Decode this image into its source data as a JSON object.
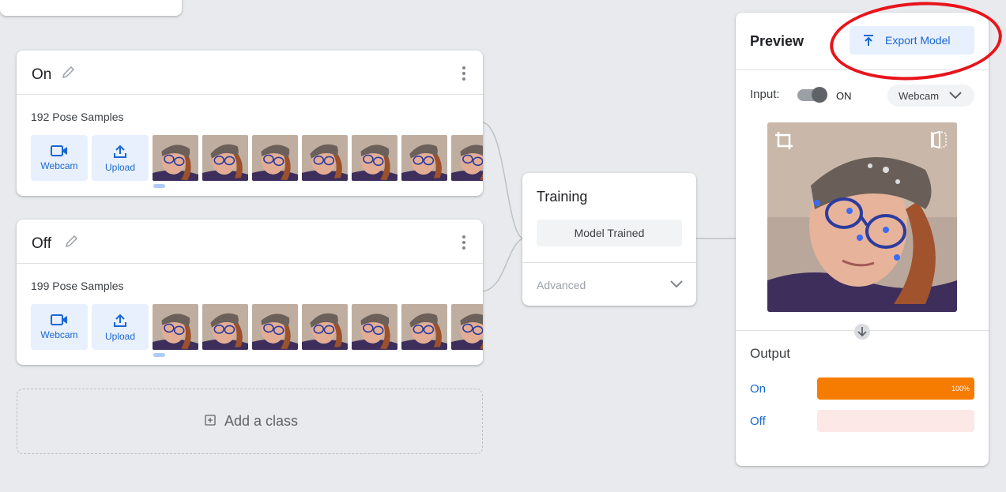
{
  "classes": [
    {
      "name": "On",
      "samples_label": "192 Pose Samples",
      "webcam_label": "Webcam",
      "upload_label": "Upload"
    },
    {
      "name": "Off",
      "samples_label": "199 Pose Samples",
      "webcam_label": "Webcam",
      "upload_label": "Upload"
    }
  ],
  "add_class_label": "Add a class",
  "training": {
    "title": "Training",
    "button_label": "Model Trained",
    "advanced_label": "Advanced"
  },
  "preview": {
    "title": "Preview",
    "export_label": "Export Model",
    "input_label": "Input:",
    "toggle_state": "ON",
    "source_select": "Webcam",
    "output_label": "Output",
    "outputs": [
      {
        "name": "On",
        "percent_text": "100%",
        "fraction": 1.0,
        "color": "#f57c00"
      },
      {
        "name": "Off",
        "percent_text": "",
        "fraction": 0.0,
        "color": "#fce8e6"
      }
    ]
  },
  "colors": {
    "accent": "#1967d2",
    "annotation": "#e8141c"
  }
}
